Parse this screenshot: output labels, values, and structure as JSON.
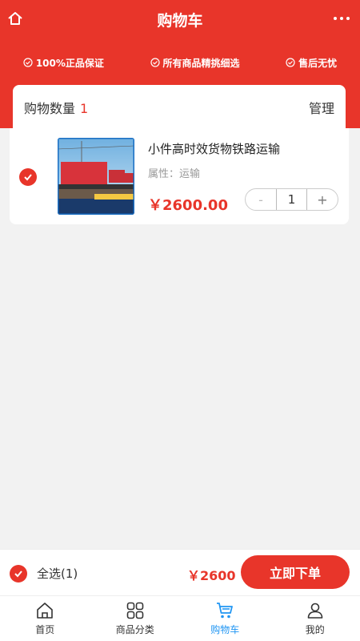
{
  "header": {
    "title": "购物车"
  },
  "guarantees": [
    "100%正品保证",
    "所有商品精挑细选",
    "售后无忧"
  ],
  "cart": {
    "count_label": "购物数量",
    "count": "1",
    "manage_label": "管理"
  },
  "product": {
    "name": "小件高时效货物铁路运输",
    "attribute": "属性：运输",
    "price": "￥2600.00",
    "quantity": "1",
    "minus": "-",
    "plus": "+",
    "image_text": {
      "badge_left": "经验丰富",
      "tagline": "真诚服务 迅速快捷"
    }
  },
  "footer": {
    "select_all": "全选(1)",
    "total": "￥2600",
    "order_button": "立即下单"
  },
  "tabs": [
    {
      "label": "首页",
      "icon": "home-icon"
    },
    {
      "label": "商品分类",
      "icon": "category-icon"
    },
    {
      "label": "购物车",
      "icon": "cart-icon"
    },
    {
      "label": "我的",
      "icon": "user-icon"
    }
  ],
  "colors": {
    "primary": "#e8352a",
    "active_tab": "#2196f3"
  }
}
